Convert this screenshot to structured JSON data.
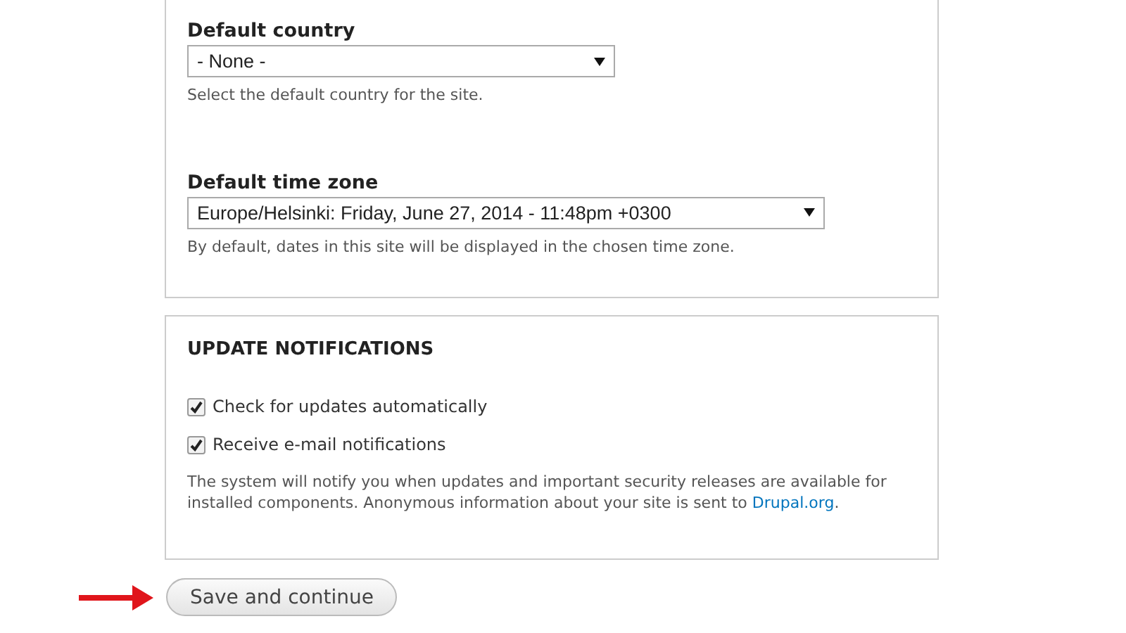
{
  "regional_settings": {
    "fields": [
      {
        "kind": "select",
        "label": "Default country",
        "value": "- None -",
        "description": "Select the default country for the site."
      },
      {
        "kind": "select",
        "label": "Default time zone",
        "value": "Europe/Helsinki: Friday, June 27, 2014 - 11:48pm +0300",
        "description": "By default, dates in this site will be displayed in the chosen time zone."
      }
    ]
  },
  "update_notifications": {
    "title": "UPDATE NOTIFICATIONS",
    "checkboxes": [
      {
        "label": "Check for updates automatically",
        "checked": true
      },
      {
        "label": "Receive e-mail notifications",
        "checked": true
      }
    ],
    "description": {
      "text": "The system will notify you when updates and important security releases are available for installed components. Anonymous information about your site is sent to ",
      "link": "Drupal.org",
      "after": "."
    }
  },
  "submit": {
    "label": "Save and continue"
  }
}
